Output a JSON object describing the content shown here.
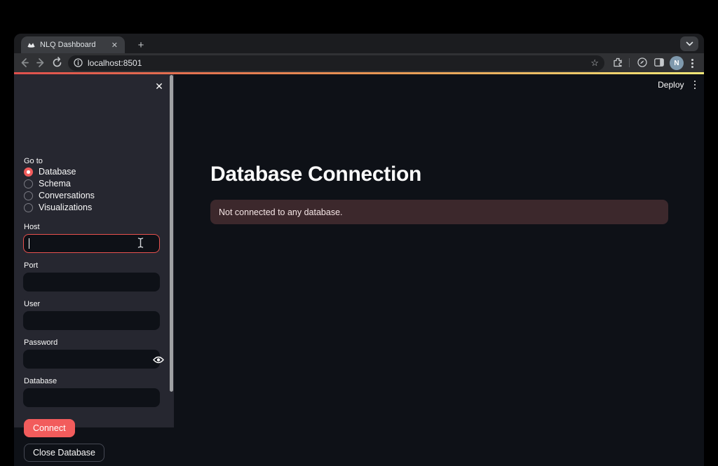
{
  "colors": {
    "accent": "#ff4b4b",
    "app_background": "#0e1117",
    "sidebar_background": "#262730",
    "error_background": "#3c282c",
    "decoration_gradient": [
      "#e0504d",
      "#e89a55",
      "#f2e878"
    ],
    "connect_button": "#f25c5c"
  },
  "browser": {
    "tab_title": "NLQ Dashboard",
    "url": "localhost:8501",
    "profile_initial": "N",
    "icons": {
      "tab_close": "✕",
      "new_tab": "+",
      "bookmark_star": "☆"
    }
  },
  "app": {
    "header": {
      "deploy_label": "Deploy"
    },
    "sidebar": {
      "close_icon": "✕",
      "nav_label": "Go to",
      "nav_options": [
        {
          "label": "Database",
          "selected": true
        },
        {
          "label": "Schema",
          "selected": false
        },
        {
          "label": "Conversations",
          "selected": false
        },
        {
          "label": "Visualizations",
          "selected": false
        }
      ],
      "fields": [
        {
          "label": "Host",
          "value": "",
          "focused": true
        },
        {
          "label": "Port",
          "value": ""
        },
        {
          "label": "User",
          "value": ""
        },
        {
          "label": "Password",
          "value": "",
          "masked": true
        },
        {
          "label": "Database",
          "value": ""
        }
      ],
      "connect_button": "Connect",
      "close_database_button": "Close Database"
    },
    "main": {
      "heading": "Database Connection",
      "error_message": "Not connected to any database."
    }
  }
}
